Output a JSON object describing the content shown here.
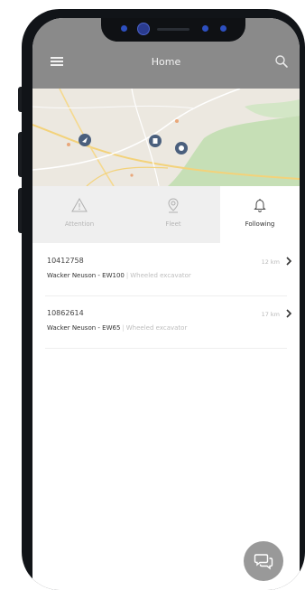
{
  "header": {
    "title": "Home",
    "menu_icon": "menu-icon",
    "search_icon": "search-icon",
    "background": "#8a8a8a"
  },
  "map": {
    "markers": [
      "navigation-marker",
      "fuel-marker",
      "location-marker"
    ]
  },
  "tabs": [
    {
      "label": "Attention",
      "icon": "warning-icon",
      "active": false
    },
    {
      "label": "Fleet",
      "icon": "location-pin-icon",
      "active": false
    },
    {
      "label": "Following",
      "icon": "bell-icon",
      "active": true
    }
  ],
  "machines": [
    {
      "id": "10412758",
      "model": "Wacker Neuson - EW100",
      "type": "Wheeled excavator",
      "distance": "12 km"
    },
    {
      "id": "10862614",
      "model": "Wacker Neuson - EW65",
      "type": "Wheeled excavator",
      "distance": "17 km"
    }
  ],
  "fab": {
    "icon": "chat-icon"
  },
  "colors": {
    "accent": "#3f5f86",
    "tab_inactive": "#efefef"
  }
}
